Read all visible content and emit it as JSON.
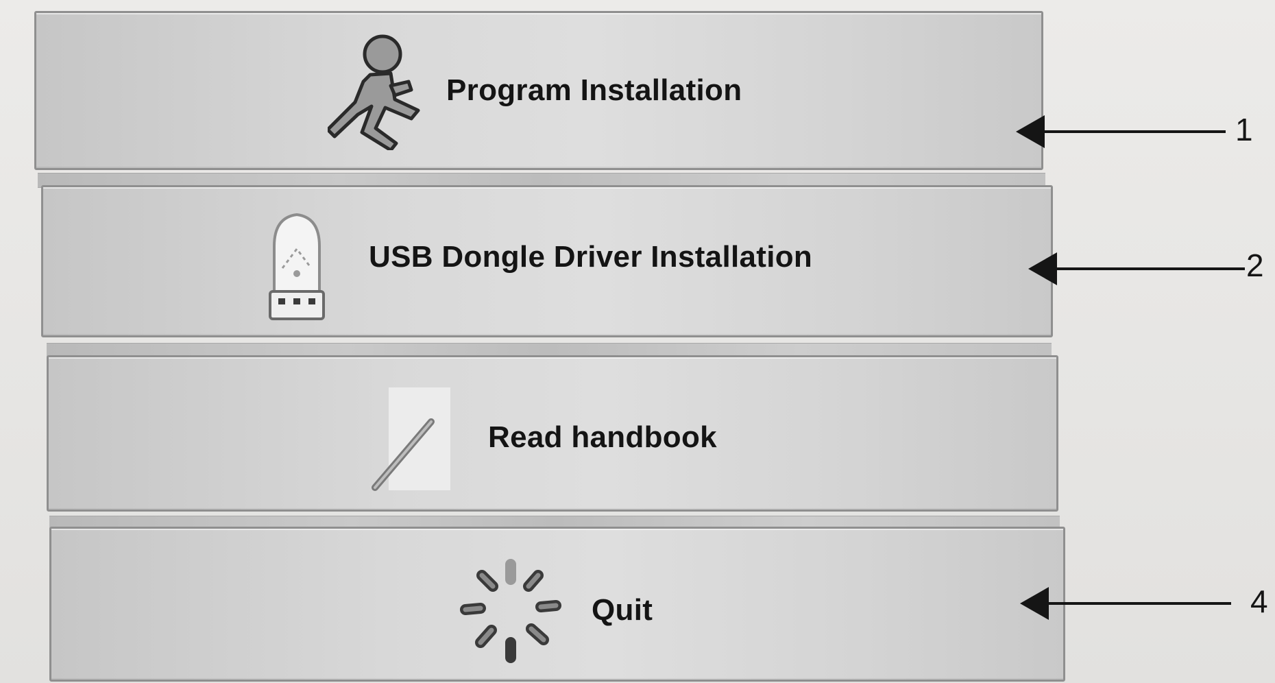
{
  "buttons": [
    {
      "label": "Program Installation",
      "icon": "running-person-icon"
    },
    {
      "label": "USB Dongle Driver Installation",
      "icon": "usb-dongle-icon"
    },
    {
      "label": "Read handbook",
      "icon": "pen-page-icon"
    },
    {
      "label": "Quit",
      "icon": "spinner-icon"
    }
  ],
  "callouts": [
    "1",
    "2",
    "4"
  ],
  "colors": {
    "button_face": "#d9d9d9",
    "button_border": "#8f8f8f",
    "text": "#141414",
    "background": "#e9e8e6"
  }
}
